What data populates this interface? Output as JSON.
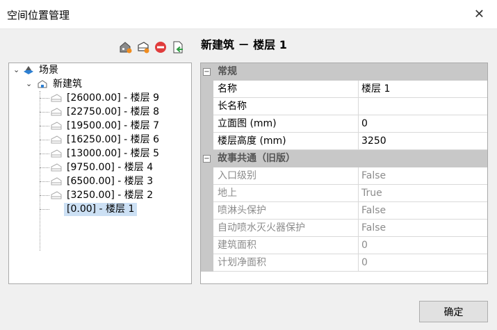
{
  "window": {
    "title": "空间位置管理",
    "close_glyph": "✕"
  },
  "toolbar": {
    "icons": [
      "add-building-icon",
      "add-floor-icon",
      "delete-icon",
      "export-icon"
    ]
  },
  "tree": {
    "root": "场景",
    "building": "新建筑",
    "floors": [
      "[26000.00] - 楼层 9",
      "[22750.00] - 楼层 8",
      "[19500.00] - 楼层 7",
      "[16250.00] - 楼层 6",
      "[13000.00] - 楼层 5",
      "[9750.00] - 楼层 4",
      "[6500.00] - 楼层 3",
      "[3250.00] - 楼层 2",
      "[0.00] - 楼层 1"
    ],
    "selected_index": 8
  },
  "properties": {
    "heading": "新建筑 － 楼层 1",
    "general_title": "常规",
    "general": [
      {
        "name": "名称",
        "value": "楼层 1"
      },
      {
        "name": "长名称",
        "value": ""
      },
      {
        "name": "立面图 (mm)",
        "value": "0"
      },
      {
        "name": "楼层高度 (mm)",
        "value": "3250"
      }
    ],
    "legacy_title": "故事共通（旧版）",
    "legacy": [
      {
        "name": "入口级别",
        "value": "False"
      },
      {
        "name": "地上",
        "value": "True"
      },
      {
        "name": "喷淋头保护",
        "value": "False"
      },
      {
        "name": "自动喷水灭火器保护",
        "value": "False"
      },
      {
        "name": "建筑面积",
        "value": "0"
      },
      {
        "name": "计划净面积",
        "value": "0"
      }
    ]
  },
  "buttons": {
    "ok": "确定"
  },
  "colors": {
    "category_bg": "#c8c8c8",
    "selection": "#cce0f4",
    "delete_red": "#e03c3c",
    "export_green": "#2f9e44"
  }
}
